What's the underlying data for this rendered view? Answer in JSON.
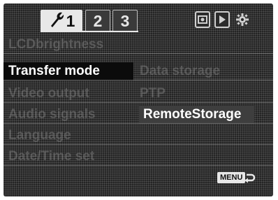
{
  "tabs": [
    {
      "label": "1",
      "icon": "wrench-icon",
      "active": true
    },
    {
      "label": "2",
      "active": false
    },
    {
      "label": "3",
      "active": false
    }
  ],
  "mode_icons": [
    "camera-record-icon",
    "playback-icon",
    "setup-gear-icon"
  ],
  "menu_items": [
    {
      "label": "LCDbrightness"
    },
    {
      "label": "Transfer mode",
      "selected": true
    },
    {
      "label": "Video output"
    },
    {
      "label": "Audio signals"
    },
    {
      "label": "Language"
    },
    {
      "label": "Date/Time set"
    }
  ],
  "options": [
    {
      "label": "Data storage"
    },
    {
      "label": "PTP"
    },
    {
      "label": "RemoteStorage",
      "selected": true
    }
  ],
  "footer": {
    "menu_label": "MENU",
    "return_icon": "return-arrow-icon"
  },
  "colors": {
    "background": "#252525",
    "selected_item_bg": "#0b0b0b",
    "selected_option_bg": "#3e3e3e",
    "text_active": "#ffffff",
    "tab_active_bg": "#e8e8e8"
  }
}
